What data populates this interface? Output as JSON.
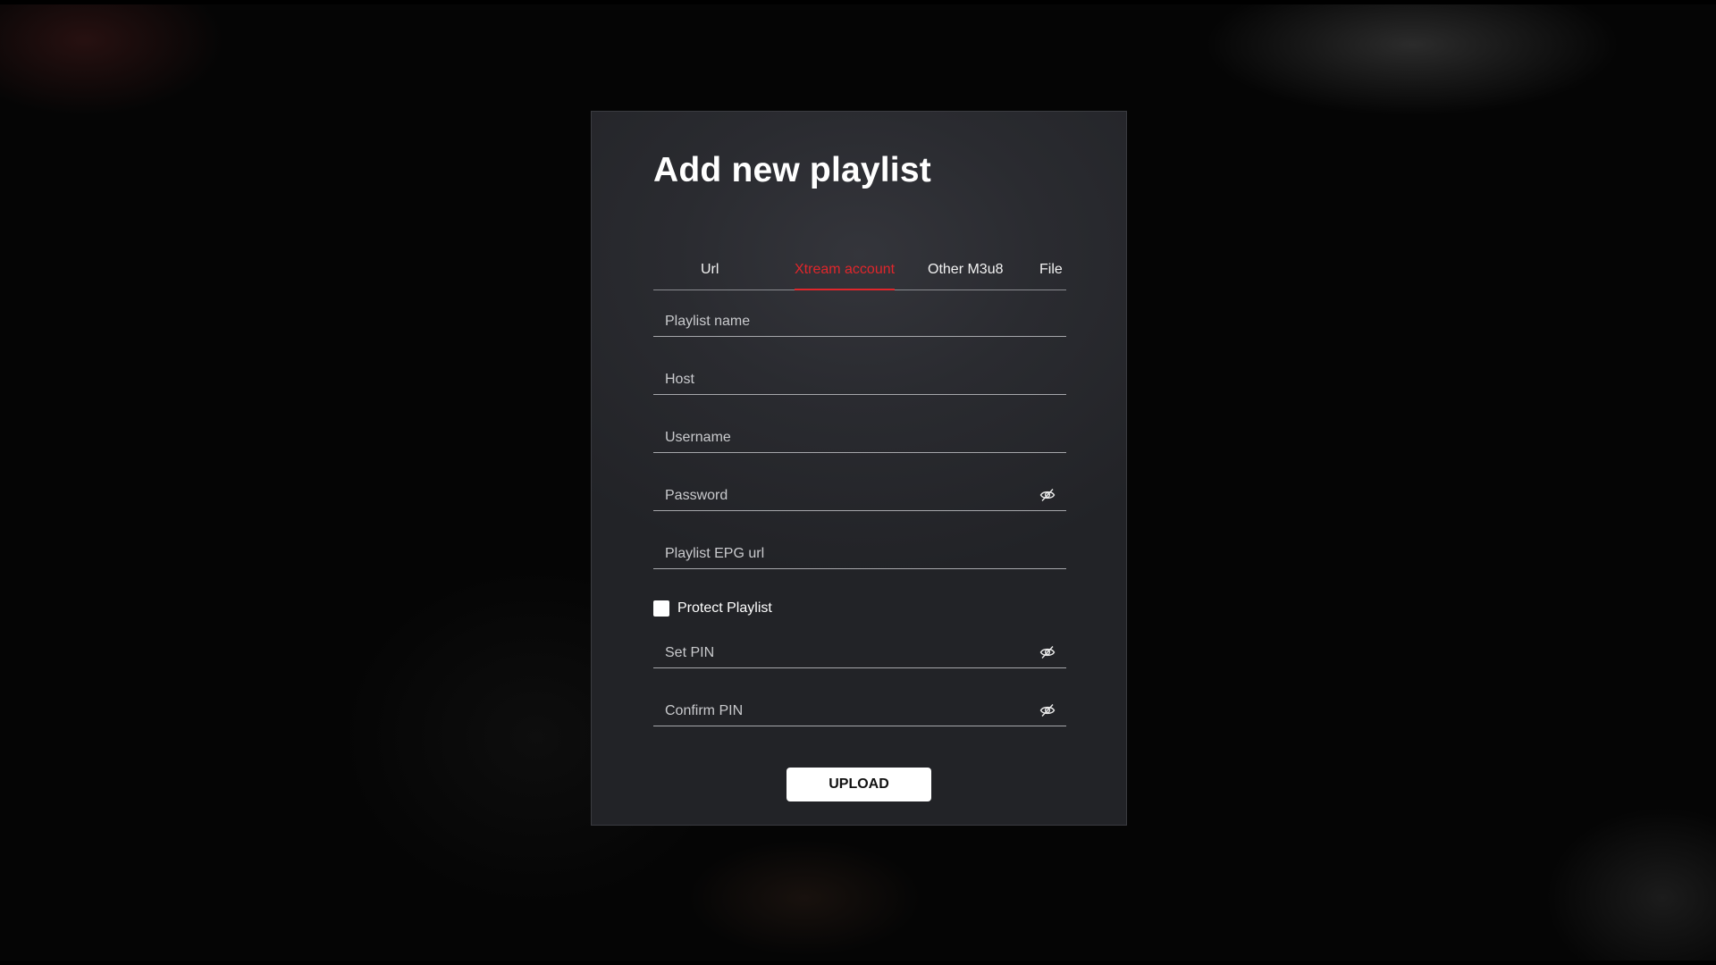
{
  "dialog": {
    "title": "Add new playlist",
    "tabs": [
      {
        "label": "Url",
        "active": false
      },
      {
        "label": "Xtream account",
        "active": true
      },
      {
        "label": "Other M3u8",
        "active": false
      },
      {
        "label": "File",
        "active": false
      }
    ],
    "fields": {
      "playlist_name": {
        "placeholder": "Playlist name",
        "value": ""
      },
      "host": {
        "placeholder": "Host",
        "value": ""
      },
      "username": {
        "placeholder": "Username",
        "value": ""
      },
      "password": {
        "placeholder": "Password",
        "value": ""
      },
      "epg_url": {
        "placeholder": "Playlist EPG url",
        "value": ""
      },
      "set_pin": {
        "placeholder": "Set PIN",
        "value": ""
      },
      "confirm_pin": {
        "placeholder": "Confirm PIN",
        "value": ""
      }
    },
    "protect_playlist": {
      "label": "Protect Playlist",
      "checked": false
    },
    "upload_label": "UPLOAD"
  },
  "icons": {
    "visibility_toggle": "eye-off-icon"
  },
  "colors": {
    "accent": "#e0262b",
    "panel": "#2a2b30",
    "background": "#000000"
  }
}
